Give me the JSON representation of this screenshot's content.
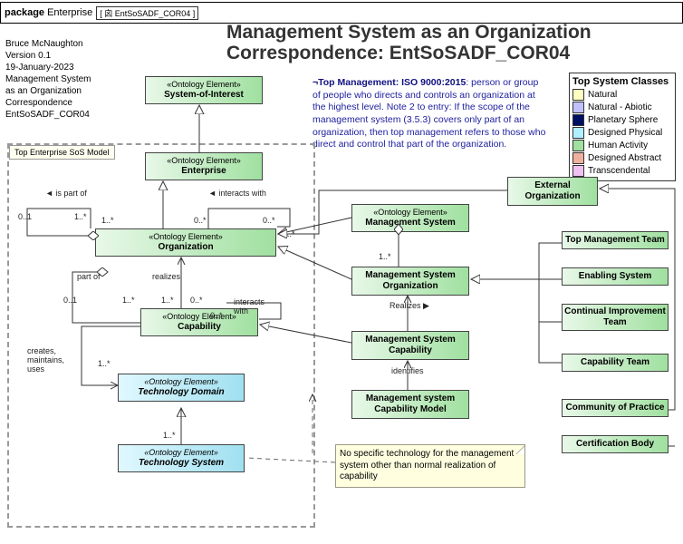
{
  "package": {
    "kw": "package",
    "scope": "Enterprise",
    "name": "EntSoSADF_COR04"
  },
  "title": {
    "l1": "Management System as an Organization",
    "l2": "Correspondence:  EntSoSADF_COR04"
  },
  "meta": {
    "author": "Bruce McNaughton",
    "version": "Version 0.1",
    "date": "19-January-2023",
    "d1": "Management System",
    "d2": "as an Organization",
    "d3": "Correspondence",
    "d4": "EntSoSADF_COR04"
  },
  "legend": {
    "title": "Top System Classes",
    "items": [
      {
        "label": "Natural",
        "c": "#ffffc0"
      },
      {
        "label": "Natural - Abiotic",
        "c": "#c0c0ff"
      },
      {
        "label": "Planetary Sphere",
        "c": "#001060"
      },
      {
        "label": "Designed Physical",
        "c": "#b0f0ff"
      },
      {
        "label": "Human Activity",
        "c": "#a0e0a0"
      },
      {
        "label": "Designed Abstract",
        "c": "#f0b0a0"
      },
      {
        "label": "Transcendental",
        "c": "#f0c0f0"
      }
    ]
  },
  "definition": {
    "head": "¬Top Management:  ISO 9000:2015",
    "body": ":  person or group of people who directs and controls an organization at the highest level.  Note 2 to entry: If the scope of the management system (3.5.3) covers only part of an organization, then top management refers to those who direct and control that part of the organization."
  },
  "sos": {
    "label": "Top Enterprise SoS Model"
  },
  "classes": {
    "soi": {
      "s": "«Ontology Element»",
      "n": "System-of-Interest"
    },
    "ent": {
      "s": "«Ontology Element»",
      "n": "Enterprise"
    },
    "org": {
      "s": "«Ontology Element»",
      "n": "Organization"
    },
    "cap": {
      "s": "«Ontology Element»",
      "n": "Capability"
    },
    "tdom": {
      "s": "«Ontology Element»",
      "n": "Technology Domain"
    },
    "tsys": {
      "s": "«Ontology Element»",
      "n": "Technology System"
    },
    "ms": {
      "s": "«Ontology Element»",
      "n": "Management System"
    },
    "mso": {
      "n": "Management System Organization"
    },
    "msc": {
      "n": "Management System Capability"
    },
    "mscm": {
      "n": "Management system Capability Model"
    },
    "extorg": {
      "n": "External Organization"
    },
    "tmt": {
      "n": "Top Management Team"
    },
    "es": {
      "n": "Enabling System"
    },
    "cit": {
      "n": "Continual Improvement Team"
    },
    "ct": {
      "n": "Capability Team"
    },
    "cop": {
      "n": "Community of Practice"
    },
    "cb": {
      "n": "Certification Body"
    }
  },
  "rels": {
    "ispartof": "◄ is part of",
    "interacts": "◄ interacts with",
    "interacts2": "interacts with",
    "partof": "part of",
    "realizes": "realizes",
    "Realizes": "Realizes ▶",
    "identifies": "identifies",
    "cmu": "creates, maintains, uses"
  },
  "mult": {
    "z1": "0..1",
    "o1": "0..*",
    "m1": "1..*"
  },
  "note2": "No specific technology for the management system other than normal realization of capability"
}
